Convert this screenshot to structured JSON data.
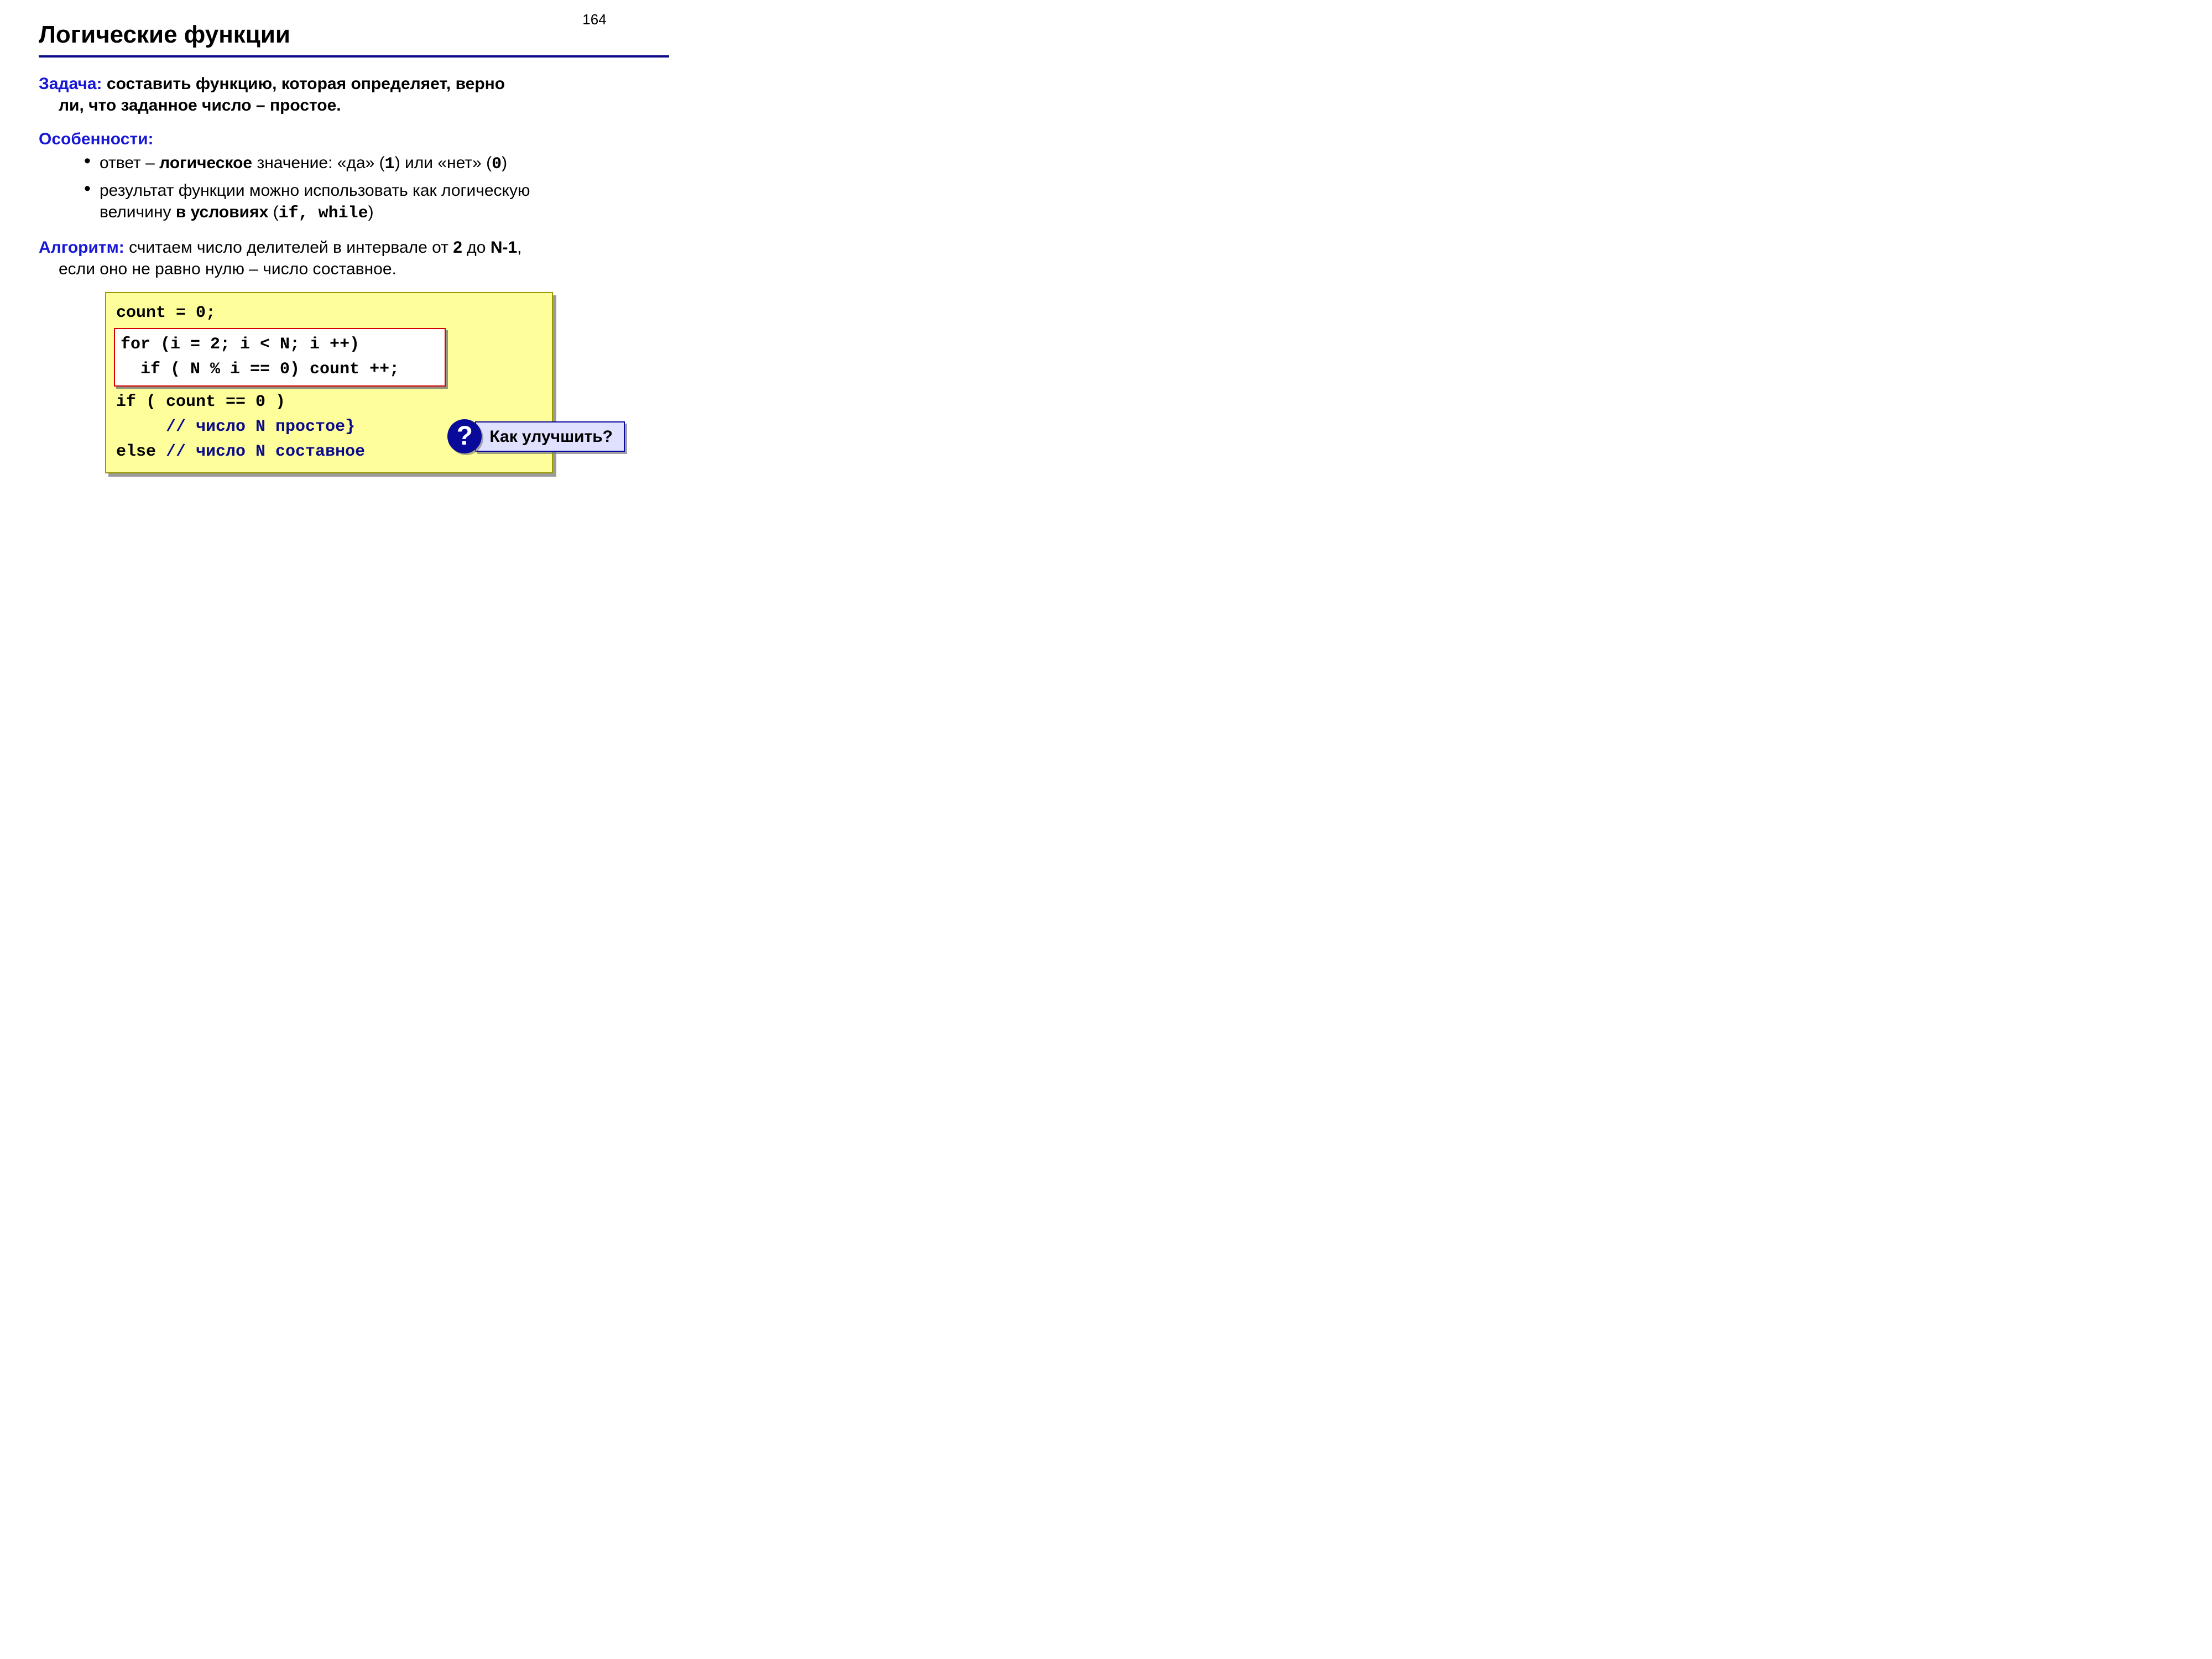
{
  "page_number": "164",
  "title": "Логические функции",
  "task": {
    "label": "Задача:",
    "text_1": " составить функцию, которая определяет, верно",
    "text_2": "ли, что заданное число – простое."
  },
  "features": {
    "label": "Особенности:",
    "items": [
      {
        "pre": "ответ – ",
        "bold": "логическое",
        "post": " значение: «да» (",
        "mono1": "1",
        "mid": ") или «нет» (",
        "mono2": "0",
        "end": ")"
      },
      {
        "line1": "результат функции можно использовать как логическую",
        "line2_pre": "величину ",
        "line2_bold": "в условиях",
        "line2_paren_open": " (",
        "line2_mono": "if,  while",
        "line2_paren_close": ")"
      }
    ]
  },
  "algorithm": {
    "label": "Алгоритм:",
    "text_1": " считаем число делителей в интервале от ",
    "bold_1": "2",
    "text_2": " до ",
    "bold_2": "N-1",
    "text_3": ",",
    "text_4": "если оно не равно нулю – число составное."
  },
  "code": {
    "l1": "count = 0;",
    "l2": "for (i = 2; i < N; i ++)",
    "l3": "  if ( N % i == 0) count ++;",
    "l4": "if ( count == 0 )",
    "l5_indent": "     ",
    "l5_comment": "// число N простое}",
    "l6_else": "else ",
    "l6_comment": "// число N составное"
  },
  "callout": {
    "mark": "?",
    "text": "Как улучшить?"
  }
}
